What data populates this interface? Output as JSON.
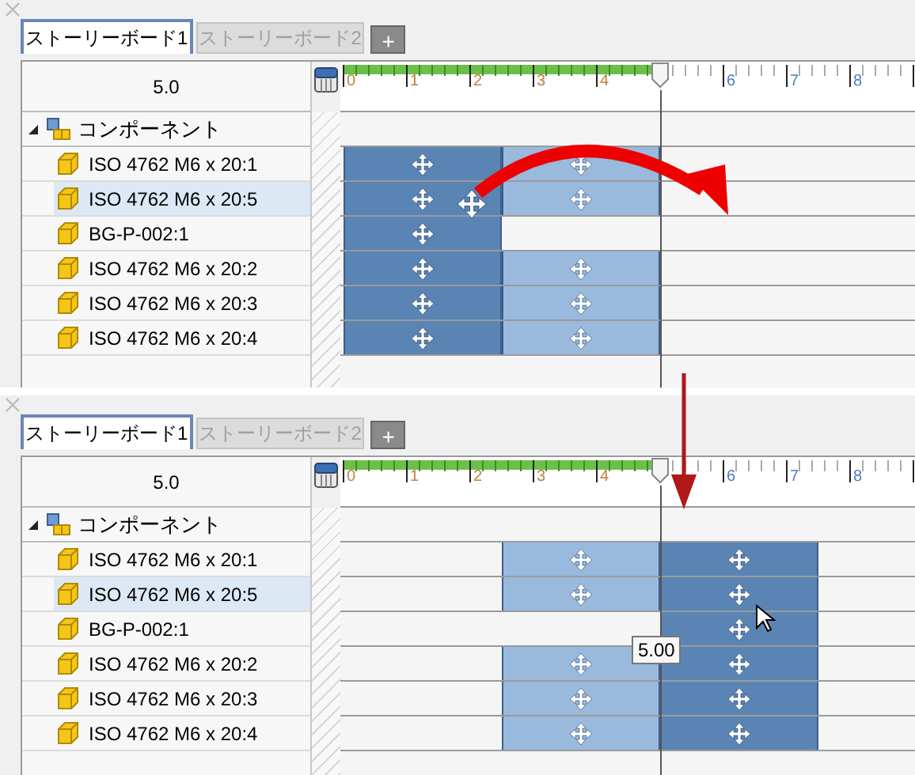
{
  "panels": [
    {
      "tabs": [
        {
          "label": "ストーリーボード1",
          "selected": true
        },
        {
          "label": "ストーリーボード2",
          "selected": false
        }
      ],
      "add_tab": "+",
      "time_value": "5.0",
      "ruler_labels_before": [
        "0",
        "1",
        "2",
        "3",
        "4"
      ],
      "ruler_labels_after": [
        "6",
        "7",
        "8"
      ],
      "root": {
        "label": "コンポーネント",
        "expanded": true
      },
      "rows": [
        {
          "label": "ISO 4762 M6 x 20:1",
          "selected": false,
          "slots": [
            {
              "kind": "dark"
            },
            {
              "kind": "light"
            }
          ]
        },
        {
          "label": "ISO 4762 M6 x 20:5",
          "selected": true,
          "slots": [
            {
              "kind": "dark"
            },
            {
              "kind": "light"
            }
          ]
        },
        {
          "label": "BG-P-002:1",
          "selected": false,
          "slots": [
            {
              "kind": "dark"
            }
          ]
        },
        {
          "label": "ISO 4762 M6 x 20:2",
          "selected": false,
          "slots": [
            {
              "kind": "dark"
            },
            {
              "kind": "light"
            }
          ]
        },
        {
          "label": "ISO 4762 M6 x 20:3",
          "selected": false,
          "slots": [
            {
              "kind": "dark"
            },
            {
              "kind": "light"
            }
          ]
        },
        {
          "label": "ISO 4762 M6 x 20:4",
          "selected": false,
          "slots": [
            {
              "kind": "dark"
            },
            {
              "kind": "light"
            }
          ]
        }
      ],
      "annotation": {
        "kind": "curved-arrow"
      },
      "cursor": {
        "kind": "move"
      }
    },
    {
      "tabs": [
        {
          "label": "ストーリーボード1",
          "selected": true
        },
        {
          "label": "ストーリーボード2",
          "selected": false
        }
      ],
      "add_tab": "+",
      "time_value": "5.0",
      "ruler_labels_before": [
        "0",
        "1",
        "2",
        "3",
        "4"
      ],
      "ruler_labels_after": [
        "6",
        "7",
        "8"
      ],
      "root": {
        "label": "コンポーネント",
        "expanded": true
      },
      "rows": [
        {
          "label": "ISO 4762 M6 x 20:1",
          "selected": false,
          "slots": [
            {
              "kind": "none"
            },
            {
              "kind": "light"
            },
            {
              "kind": "dark"
            }
          ]
        },
        {
          "label": "ISO 4762 M6 x 20:5",
          "selected": true,
          "slots": [
            {
              "kind": "none"
            },
            {
              "kind": "light"
            },
            {
              "kind": "dark"
            }
          ]
        },
        {
          "label": "BG-P-002:1",
          "selected": false,
          "slots": [
            {
              "kind": "none"
            },
            {
              "kind": "none"
            },
            {
              "kind": "dark"
            }
          ]
        },
        {
          "label": "ISO 4762 M6 x 20:2",
          "selected": false,
          "slots": [
            {
              "kind": "none"
            },
            {
              "kind": "light"
            },
            {
              "kind": "dark"
            }
          ]
        },
        {
          "label": "ISO 4762 M6 x 20:3",
          "selected": false,
          "slots": [
            {
              "kind": "none"
            },
            {
              "kind": "light"
            },
            {
              "kind": "dark"
            }
          ]
        },
        {
          "label": "ISO 4762 M6 x 20:4",
          "selected": false,
          "slots": [
            {
              "kind": "none"
            },
            {
              "kind": "light"
            },
            {
              "kind": "dark"
            }
          ]
        }
      ],
      "tooltip": "5.00",
      "annotation": {
        "kind": "down-arrow"
      },
      "cursor": {
        "kind": "pointer"
      }
    }
  ]
}
